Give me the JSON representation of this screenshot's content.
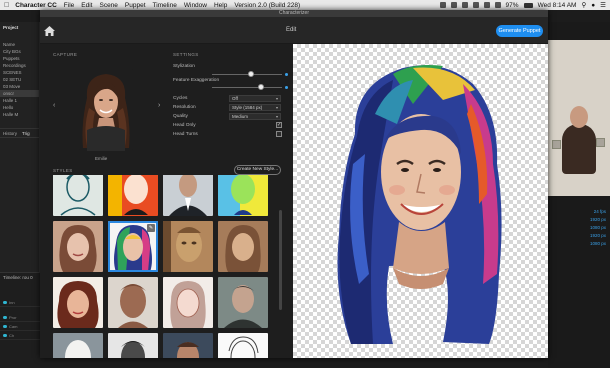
{
  "menubar": {
    "app_name": "Character CC",
    "items": [
      "File",
      "Edit",
      "Scene",
      "Puppet",
      "Timeline",
      "Window",
      "Help"
    ],
    "version": "Version 2.0 (Build 228)",
    "battery": "97%",
    "clock": "Wed 8:14 AM"
  },
  "background_app": {
    "project_label": "Project",
    "name_label": "Name",
    "items": [
      "City BGs",
      "Puppets",
      "Recordings",
      "SCENES",
      "02 SETU",
      "03 Move",
      "onscr",
      "Halle 1",
      "Hello",
      "Halle M"
    ],
    "selected_index": 6,
    "history_tab": "History",
    "trig_tab": "Trig",
    "timeline_label": "Timeline: rou 0",
    "tracks": [
      "Inn",
      "Pror",
      "Cam",
      "Ch"
    ],
    "props": [
      "24 fps",
      "1920 px",
      "1080 px",
      "1920 px",
      "1080 px"
    ]
  },
  "dialog": {
    "title": "Characterizer",
    "mode": "Edit",
    "generate_label": "Generate Puppet",
    "capture_section": "CAPTURE",
    "capture_name": "Emilie",
    "settings_section": "SETTINGS",
    "settings": {
      "stylization_label": "Stylization",
      "stylization_value": 0.55,
      "exaggeration_label": "Feature Exaggeration",
      "exaggeration_value": 0.7,
      "cycles_label": "Cycles",
      "cycles_value": "Off",
      "resolution_label": "Resolution",
      "resolution_value": "Style (1584 px)",
      "quality_label": "Quality",
      "quality_value": "Medium",
      "head_only_label": "Head Only",
      "head_only_checked": true,
      "head_turns_label": "Head Turns",
      "head_turns_checked": false
    },
    "styles_section": "STYLES",
    "create_style_label": "Create New Style...",
    "styles": [
      "line-art",
      "pop-orange",
      "suit-photo",
      "neon-pop",
      "painted-portrait",
      "rainbow-paint",
      "clay-tiki",
      "wood-carving",
      "ink-watercolor",
      "clay-bust",
      "pencil-sketch",
      "grey-photo",
      "white-bust",
      "bw-photo",
      "beard-photo",
      "line-sketch"
    ],
    "selected_style": 5
  }
}
